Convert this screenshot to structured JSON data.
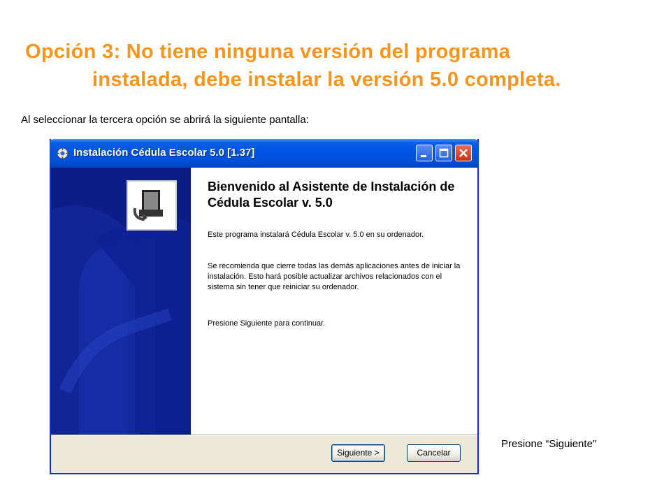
{
  "slide": {
    "title_line1": "Opción 3: No tiene ninguna versión del programa",
    "title_line2": "instalada, debe instalar la versión 5.0 completa.",
    "intro": "Al seleccionar la tercera opción se abrirá la siguiente pantalla:",
    "caption": "Presione “Siguiente\"",
    "title_color": "#F7941D"
  },
  "window": {
    "title": "Instalación Cédula Escolar 5.0 [1.37]",
    "title_icon": "installer-icon",
    "controls": [
      "minimize-icon",
      "maximize-icon",
      "close-icon"
    ],
    "sidebar_logo": "computer-install-icon",
    "welcome_title": "Bienvenido al Asistente de Instalación de Cédula Escolar v. 5.0",
    "paragraph1": "Este programa instalará Cédula Escolar v. 5.0 en su ordenador.",
    "paragraph2": "Se recomienda que cierre todas las demás aplicaciones antes de iniciar la instalación. Esto hará posible actualizar archivos relacionados con el sistema sin tener que reiniciar su ordenador.",
    "paragraph3": "Presione Siguiente para continuar.",
    "buttons": {
      "next": "Siguiente >",
      "cancel": "Cancelar"
    },
    "colors": {
      "titlebar": "#0054E3",
      "sidebar": "#0B1D86",
      "close": "#C5331A"
    }
  }
}
